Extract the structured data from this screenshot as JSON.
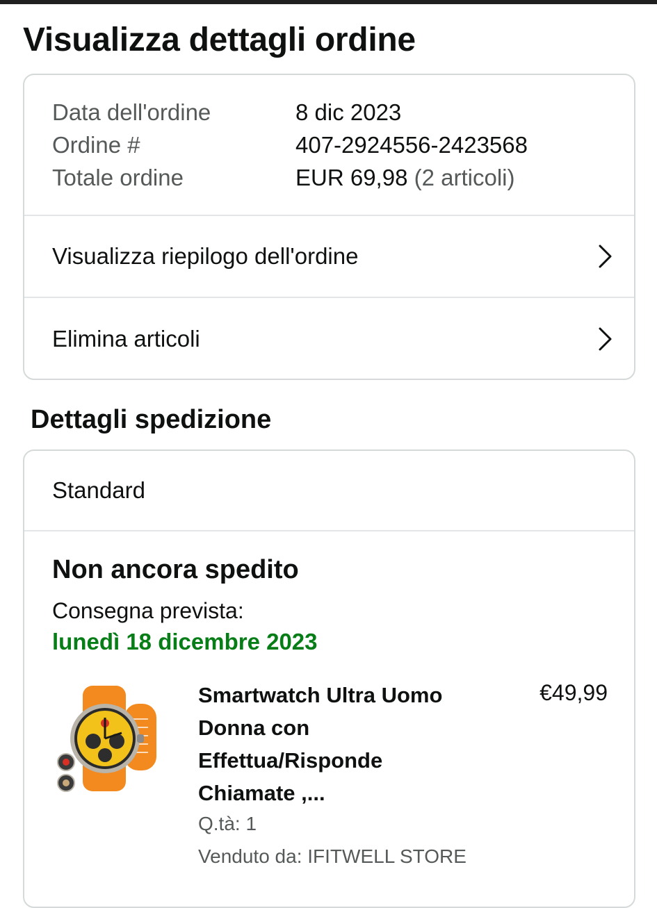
{
  "page": {
    "title": "Visualizza dettagli ordine"
  },
  "order_info": {
    "date_label": "Data dell'ordine",
    "date_value": "8 dic 2023",
    "number_label": "Ordine #",
    "number_value": "407-2924556-2423568",
    "total_label": "Totale ordine",
    "total_value": "EUR 69,98",
    "total_items": "(2 articoli)"
  },
  "order_links": [
    {
      "label": "Visualizza riepilogo dell'ordine",
      "icon": "chevron-right-icon"
    },
    {
      "label": "Elimina articoli",
      "icon": "chevron-right-icon"
    }
  ],
  "shipping": {
    "section_title": "Dettagli spedizione",
    "type": "Standard",
    "status": "Non ancora spedito",
    "delivery_label": "Consegna prevista:",
    "delivery_date": "lunedì 18 dicembre 2023"
  },
  "product": {
    "name": "Smartwatch Ultra Uomo Donna con Effettua/Risponde Chiamate ,...",
    "price": "€49,99",
    "qty": "Q.tà: 1",
    "seller": "Venduto da: IFITWELL STORE",
    "image_icon": "smartwatch-image"
  },
  "colors": {
    "delivery_green": "#067d17",
    "border": "#d5d9d9",
    "watch_orange": "#f28a1f",
    "watch_face": "#f2c21a"
  }
}
